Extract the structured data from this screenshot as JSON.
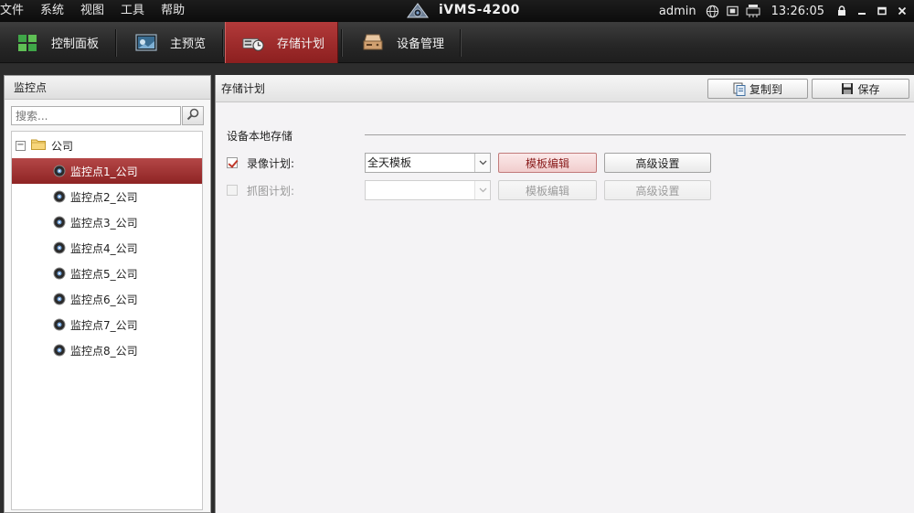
{
  "menubar": {
    "items": [
      "文件",
      "系统",
      "视图",
      "工具",
      "帮助"
    ],
    "app_title": "iVMS-4200",
    "user": "admin",
    "clock": "13:26:05"
  },
  "tabs": [
    {
      "label": "控制面板",
      "icon": "grid-icon"
    },
    {
      "label": "主预览",
      "icon": "preview-icon"
    },
    {
      "label": "存储计划",
      "icon": "storage-icon",
      "active": true
    },
    {
      "label": "设备管理",
      "icon": "device-icon"
    }
  ],
  "left_panel": {
    "title": "监控点",
    "search_placeholder": "搜索...",
    "root": "公司",
    "items": [
      "监控点1_公司",
      "监控点2_公司",
      "监控点3_公司",
      "监控点4_公司",
      "监控点5_公司",
      "监控点6_公司",
      "监控点7_公司",
      "监控点8_公司"
    ],
    "selected_index": 0
  },
  "right_panel": {
    "title": "存储计划",
    "copy_to": "复制到",
    "save": "保存",
    "section": "设备本地存储",
    "record_plan": {
      "label": "录像计划:",
      "checked": true,
      "value": "全天模板",
      "template_btn": "模板编辑",
      "advanced_btn": "高级设置"
    },
    "capture_plan": {
      "label": "抓图计划:",
      "checked": false,
      "value": "",
      "template_btn": "模板编辑",
      "advanced_btn": "高级设置"
    }
  },
  "colors": {
    "accent": "#9e2c2c",
    "menubar": "#111111",
    "panel": "#f4f3f5"
  }
}
